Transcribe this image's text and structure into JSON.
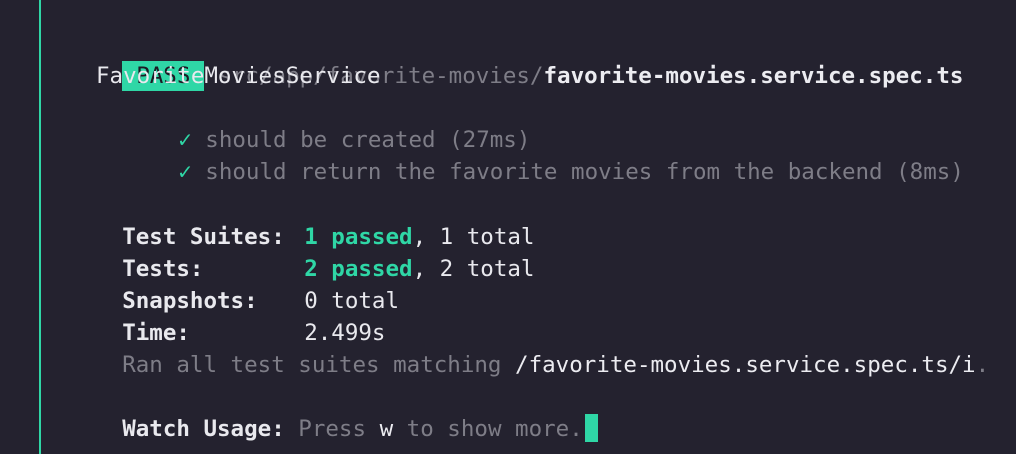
{
  "colors": {
    "background": "#24222f",
    "accent": "#2fd7a6",
    "dim_text": "#7e7d87",
    "bright_text": "#ececf1"
  },
  "result": {
    "badge": "PASS",
    "path_dir": "src/app/favorite-movies/",
    "path_file": "favorite-movies.service.spec.ts"
  },
  "suite": {
    "name": "FavoriteMoviesService",
    "tests": [
      {
        "check": "✓",
        "label": "should be created (27ms)"
      },
      {
        "check": "✓",
        "label": "should return the favorite movies from the backend (8ms)"
      }
    ]
  },
  "summary": {
    "suites_label": "Test Suites:",
    "suites_passed": "1 passed",
    "suites_total": ", 1 total",
    "tests_label": "Tests:",
    "tests_passed": "2 passed",
    "tests_total": ", 2 total",
    "snapshots_label": "Snapshots:",
    "snapshots_value": "0 total",
    "time_label": "Time:",
    "time_value": "2.499s",
    "ran_prefix": "Ran all test suites matching ",
    "ran_pattern": "/favorite-movies.service.spec.ts/i",
    "ran_suffix": "."
  },
  "watch": {
    "label": "Watch Usage:",
    "press": " Press ",
    "key": "w",
    "rest": " to show more."
  }
}
